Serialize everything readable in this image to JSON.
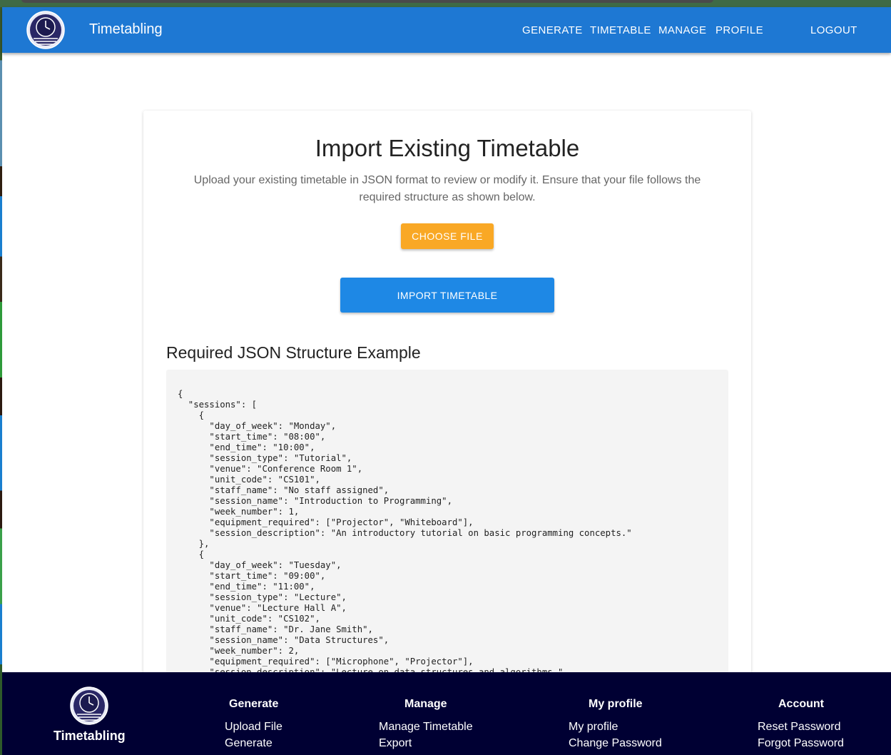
{
  "app": {
    "brand": "Timetabling"
  },
  "nav": {
    "generate": "GENERATE",
    "timetable": "TIMETABLE",
    "manage": "MANAGE",
    "profile": "PROFILE",
    "logout": "LOGOUT"
  },
  "main": {
    "title": "Import Existing Timetable",
    "description": "Upload your existing timetable in JSON format to review or modify it. Ensure that your file follows the required structure as shown below.",
    "choose_file": "CHOOSE FILE",
    "import_button": "IMPORT TIMETABLE",
    "example_heading": "Required JSON Structure Example",
    "example_code": "{\n  \"sessions\": [\n    {\n      \"day_of_week\": \"Monday\",\n      \"start_time\": \"08:00\",\n      \"end_time\": \"10:00\",\n      \"session_type\": \"Tutorial\",\n      \"venue\": \"Conference Room 1\",\n      \"unit_code\": \"CS101\",\n      \"staff_name\": \"No staff assigned\",\n      \"session_name\": \"Introduction to Programming\",\n      \"week_number\": 1,\n      \"equipment_required\": [\"Projector\", \"Whiteboard\"],\n      \"session_description\": \"An introductory tutorial on basic programming concepts.\"\n    },\n    {\n      \"day_of_week\": \"Tuesday\",\n      \"start_time\": \"09:00\",\n      \"end_time\": \"11:00\",\n      \"session_type\": \"Lecture\",\n      \"venue\": \"Lecture Hall A\",\n      \"unit_code\": \"CS102\",\n      \"staff_name\": \"Dr. Jane Smith\",\n      \"session_name\": \"Data Structures\",\n      \"week_number\": 2,\n      \"equipment_required\": [\"Microphone\", \"Projector\"],\n      \"session_description\": \"Lecture on data structures and algorithms.\""
  },
  "footer": {
    "brand": "Timetabling",
    "columns": [
      {
        "heading": "Generate",
        "links": [
          "Upload File",
          "Generate"
        ]
      },
      {
        "heading": "Manage",
        "links": [
          "Manage Timetable",
          "Export"
        ]
      },
      {
        "heading": "My profile",
        "links": [
          "My profile",
          "Change Password"
        ]
      },
      {
        "heading": "Account",
        "links": [
          "Reset Password",
          "Forgot Password"
        ]
      }
    ]
  },
  "colors": {
    "header": "#1e78d3",
    "choose_button": "#f9a825",
    "import_button": "#1e88e5",
    "footer": "#000033"
  },
  "icons": {
    "logo": "clock-logo-icon"
  }
}
